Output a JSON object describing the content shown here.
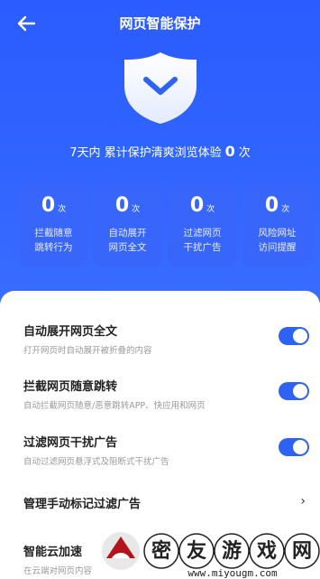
{
  "header": {
    "title": "网页智能保护",
    "back_icon": "arrow-left-icon"
  },
  "summary": {
    "prefix": "7天内 累计保护清爽浏览体验",
    "count": "0",
    "suffix": "次"
  },
  "stats": [
    {
      "value": "0",
      "unit": "次",
      "label_line1": "拦截随意",
      "label_line2": "跳转行为"
    },
    {
      "value": "0",
      "unit": "次",
      "label_line1": "自动展开",
      "label_line2": "网页全文"
    },
    {
      "value": "0",
      "unit": "次",
      "label_line1": "过滤网页",
      "label_line2": "干扰广告"
    },
    {
      "value": "0",
      "unit": "次",
      "label_line1": "风险网址",
      "label_line2": "访问提醒"
    }
  ],
  "settings": [
    {
      "title": "自动展开网页全文",
      "desc": "打开网页时自动展开被折叠的内容",
      "enabled": true
    },
    {
      "title": "拦截网页随意跳转",
      "desc": "自动拦截网页随意/恶意跳转APP、快应用和网页",
      "enabled": true
    },
    {
      "title": "过滤网页干扰广告",
      "desc": "自动过滤网页悬浮式及阻断式干扰广告",
      "enabled": true
    },
    {
      "title": "管理手动标记过滤广告",
      "chevron": "›"
    },
    {
      "title": "智能云加速",
      "desc": "在云端对网页内容"
    }
  ],
  "watermark": {
    "text": "密友游戏网",
    "url": "www.miyougm.com"
  },
  "colors": {
    "primary": "#2d62f5",
    "hero": "#2f63ff"
  }
}
